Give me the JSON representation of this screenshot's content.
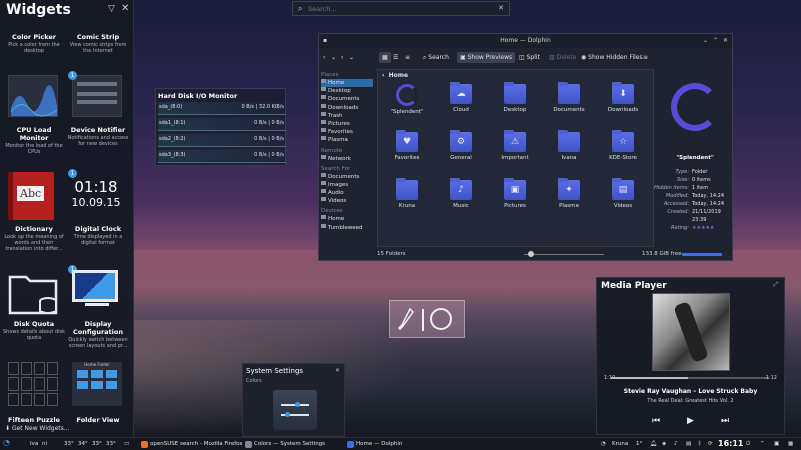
{
  "widgets_panel": {
    "title": "Widgets",
    "items": [
      {
        "name": "Color Picker",
        "desc": "Pick a color from the desktop"
      },
      {
        "name": "Comic Strip",
        "desc": "View comic strips from the Internet"
      },
      {
        "name": "CPU Load Monitor",
        "desc": "Monitor the load of the CPUs"
      },
      {
        "name": "Device Notifier",
        "desc": "Notifications and access for new devices"
      },
      {
        "name": "Dictionary",
        "desc": "Look up the meaning of words and their translation into differ..."
      },
      {
        "name": "Digital Clock",
        "desc": "Time displayed in a digital format"
      },
      {
        "name": "Disk Quota",
        "desc": "Shows details about disk quota"
      },
      {
        "name": "Display Configuration",
        "desc": "Quickly switch between screen layouts and pr..."
      },
      {
        "name": "Fifteen Puzzle",
        "desc": ""
      },
      {
        "name": "Folder View",
        "desc": ""
      }
    ],
    "badge_count": "1",
    "clock_preview": {
      "time": "01:18",
      "date": "10.09.15"
    },
    "dictionary_thumb": "Abc",
    "folder_view_thumb": "Home Folder",
    "get_new": "Get New Widgets..."
  },
  "krunner": {
    "placeholder": "Search..."
  },
  "dolphin": {
    "title": "Home — Dolphin",
    "toolbar": {
      "search": "Search",
      "show_previews": "Show Previews",
      "split": "Split",
      "delete": "Delete",
      "show_hidden": "Show Hidden Files"
    },
    "places_sections": {
      "places": "Places",
      "remote": "Remote",
      "search_for": "Search For",
      "devices": "Devices"
    },
    "places": [
      "Home",
      "Desktop",
      "Documents",
      "Downloads",
      "Trash",
      "Pictures",
      "Favorites",
      "Plasma"
    ],
    "remote": [
      "Network"
    ],
    "search_for": [
      "Documents",
      "Images",
      "Audio",
      "Videos"
    ],
    "devices": [
      "Home",
      "Tumbleweed"
    ],
    "breadcrumb": "Home",
    "files": [
      {
        "name": "\"Splendent\"",
        "glyph": ""
      },
      {
        "name": "Cloud",
        "glyph": "☁"
      },
      {
        "name": "Desktop",
        "glyph": ""
      },
      {
        "name": "Documents",
        "glyph": ""
      },
      {
        "name": "Downloads",
        "glyph": "⬇"
      },
      {
        "name": "Favorites",
        "glyph": "♥"
      },
      {
        "name": "General",
        "glyph": "⚙"
      },
      {
        "name": "Important",
        "glyph": "⚠"
      },
      {
        "name": "Ivana",
        "glyph": ""
      },
      {
        "name": "KDE-Store",
        "glyph": "☆"
      },
      {
        "name": "Kruna",
        "glyph": ""
      },
      {
        "name": "Music",
        "glyph": "♪"
      },
      {
        "name": "Pictures",
        "glyph": "▣"
      },
      {
        "name": "Plasma",
        "glyph": "✦"
      },
      {
        "name": "Videos",
        "glyph": "▤"
      }
    ],
    "status_left": "15 Folders",
    "status_right": "133.8 GiB free",
    "info": {
      "name": "\"Splendent\"",
      "rows": [
        {
          "k": "Type:",
          "v": "Folder"
        },
        {
          "k": "Size:",
          "v": "0 items"
        },
        {
          "k": "Hidden items:",
          "v": "1 item"
        },
        {
          "k": "Modified:",
          "v": "Today, 14:24"
        },
        {
          "k": "Accessed:",
          "v": "Today, 14:24"
        },
        {
          "k": "Created:",
          "v": "21/11/2019"
        },
        {
          "k": "",
          "v": "23:39"
        },
        {
          "k": "Rating:",
          "v": "★★★★★"
        }
      ]
    }
  },
  "hdd_monitor": {
    "title": "Hard Disk I/O Monitor",
    "rows": [
      {
        "name": "sda_(8:0)",
        "rate": "0 B/s | 32.0 KiB/s"
      },
      {
        "name": "sda1_(8:1)",
        "rate": "0 B/s | 0 B/s"
      },
      {
        "name": "sda2_(8:2)",
        "rate": "0 B/s | 0 B/s"
      },
      {
        "name": "sda3_(8:3)",
        "rate": "0 B/s | 0 B/s"
      }
    ]
  },
  "media_player": {
    "title": "Media Player",
    "elapsed": "1:10",
    "remaining": "-1:12",
    "progress": 0.49,
    "song": "Stevie Ray Vaughan – Love Struck Baby",
    "album": "The Real Deal: Greatest Hits Vol. 2"
  },
  "system_settings_widget": {
    "title": "System Settings",
    "subtitle": "Colors"
  },
  "taskbar": {
    "pager": [
      "Iva",
      "ni"
    ],
    "temps": [
      "33°",
      "34°",
      "33°",
      "33°"
    ],
    "tasks": [
      {
        "label": "openSUSE search - Mozilla Firefox",
        "color": "#e8742a"
      },
      {
        "label": "Colors — System Settings",
        "color": "#7f8aa0"
      },
      {
        "label": "Home — Dolphin",
        "color": "#3d6fe0"
      }
    ],
    "user": "Kruna",
    "weather": "1°",
    "clock": "16:11"
  }
}
